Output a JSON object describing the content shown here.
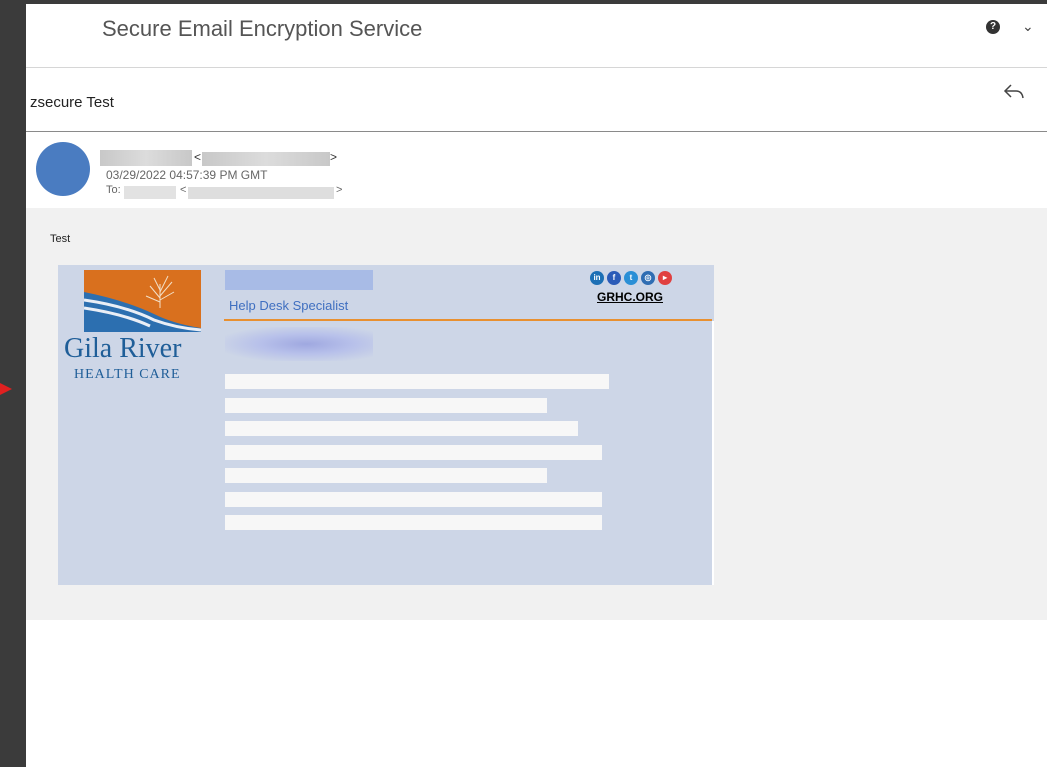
{
  "app": {
    "title": "Secure Email Encryption Service",
    "help_glyph": "?",
    "chevron_glyph": "⌄"
  },
  "message": {
    "subject": "zsecure Test",
    "sender_open": "<",
    "sender_close": ">",
    "date": "03/29/2022 04:57:39 PM GMT",
    "to_label": "To:",
    "to_open": "<",
    "to_close": ">",
    "body_text": "Test"
  },
  "signature": {
    "org_name": "Gila River",
    "org_sub": "HEALTH CARE",
    "job_title": "Help Desk Specialist",
    "website": "GRHC.ORG",
    "social": [
      {
        "name": "linkedin-icon",
        "glyph": "in",
        "color": "#1c6fb5"
      },
      {
        "name": "facebook-icon",
        "glyph": "f",
        "color": "#2a5bb8"
      },
      {
        "name": "twitter-icon",
        "glyph": "t",
        "color": "#2a8fd6"
      },
      {
        "name": "instagram-icon",
        "glyph": "◎",
        "color": "#2f6db3"
      },
      {
        "name": "youtube-icon",
        "glyph": "▸",
        "color": "#e04040"
      }
    ]
  },
  "colors": {
    "accent": "#4a7cc1",
    "signature_bg": "#cdd6e7",
    "logo_orange": "#d9701e",
    "divider_orange": "#e89030"
  }
}
